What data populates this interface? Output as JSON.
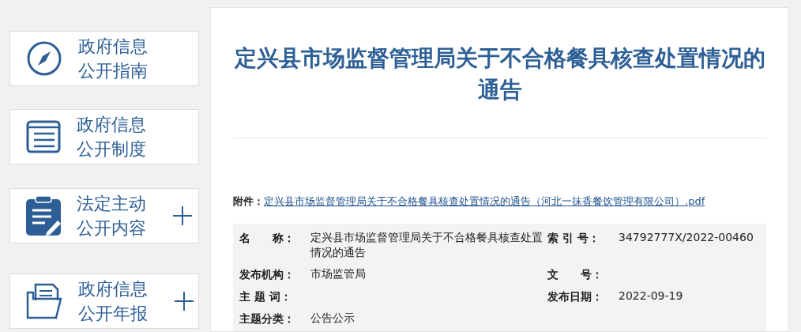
{
  "sidebar": {
    "items": [
      {
        "lines": [
          "政府信息",
          "公开指南"
        ],
        "expandable": false
      },
      {
        "lines": [
          "政府信息",
          "公开制度"
        ],
        "expandable": false
      },
      {
        "lines": [
          "法定主动",
          "公开内容"
        ],
        "expandable": true
      },
      {
        "lines": [
          "政府信息",
          "公开年报"
        ],
        "expandable": true
      }
    ]
  },
  "article": {
    "title": "定兴县市场监督管理局关于不合格餐具核查处置情况的通告",
    "attachment": {
      "label": "附件：",
      "link": "定兴县市场监督管理局关于不合格餐具核查处置情况的通告（河北一抹香餐饮管理有限公司）.pdf"
    },
    "info_rows": [
      [
        {
          "label": "名　　称：",
          "value": "定兴县市场监督管理局关于不合格餐具核查处置情况的通告"
        },
        {
          "label": "索 引 号：",
          "value": "34792777X/2022-00460"
        }
      ],
      [
        {
          "label": "发布机构：",
          "value": "市场监管局"
        },
        {
          "label": "文　　号："
        }
      ],
      [
        {
          "label": "主 题 词："
        },
        {
          "label": "发布日期：",
          "value": "2022-09-19"
        }
      ],
      [
        {
          "label": "主题分类：",
          "value": "公告公示"
        }
      ]
    ]
  }
}
